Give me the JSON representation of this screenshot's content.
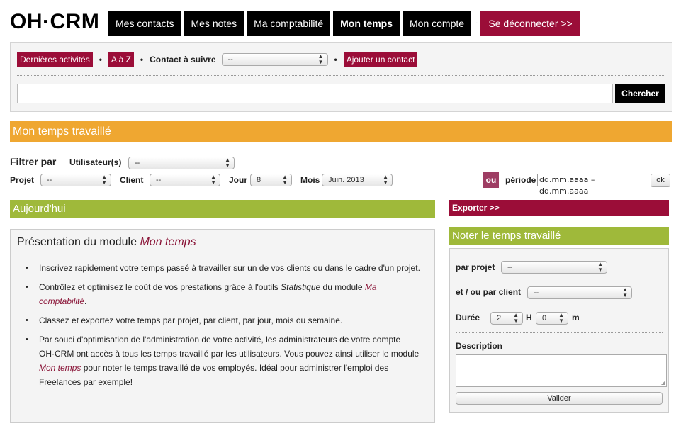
{
  "logo": "OH·CRM",
  "nav": {
    "tabs": [
      "Mes contacts",
      "Mes notes",
      "Ma comptabilité",
      "Mon temps",
      "Mon compte"
    ],
    "separator": "·",
    "logout": "Se déconnecter >>"
  },
  "toolbar": {
    "recent": "Dernières activités",
    "dot": "•",
    "az": "A à Z",
    "follow_label": "Contact à suivre",
    "follow_value": "--",
    "add_contact": "Ajouter un contact",
    "search_placeholder": "",
    "search_button": "Chercher"
  },
  "section_title": "Mon temps travaillé",
  "filters": {
    "title": "Filtrer par",
    "user_label": "Utilisateur(s)",
    "user_value": "--",
    "project_label": "Projet",
    "project_value": "--",
    "client_label": "Client",
    "client_value": "--",
    "day_label": "Jour",
    "day_value": "8",
    "month_label": "Mois",
    "month_value": "Juin. 2013",
    "or_button": "ou",
    "period_label": "période",
    "period_value": "dd.mm.aaaa – dd.mm.aaaa",
    "ok_button": "ok"
  },
  "today": {
    "title": "Aujourd'hui",
    "box_title_prefix": "Présentation du module ",
    "box_title_em": "Mon temps",
    "bullets": [
      {
        "text": "Inscrivez rapidement votre temps passé à travailler sur un de vos clients ou dans le cadre d'un projet."
      },
      {
        "pre": "Contrôlez et optimisez le coût de vos prestations grâce à l'outils ",
        "em1": "Statistique",
        "mid": " du module ",
        "em2": "Ma comptabilité",
        "post": "."
      },
      {
        "text": "Classez et exportez votre temps par projet, par client, par jour, mois ou semaine."
      },
      {
        "pre": "Par souci d'optimisation de l'administration de votre activité, les administrateurs de votre compte OH·CRM ont accès à tous les temps travaillé par les utilisateurs. Vous pouvez ainsi utiliser le module ",
        "em": "Mon temps",
        "post": " pour noter le temps travaillé de vos employés. Idéal pour administrer l'emploi des Freelances par exemple!"
      }
    ]
  },
  "export": "Exporter >>",
  "log_time": {
    "title": "Noter le temps travaillé",
    "project_label": "par projet",
    "project_value": "--",
    "client_label": "et / ou par client",
    "client_value": "--",
    "duration_label": "Durée",
    "hours_value": "2",
    "hours_unit": "H",
    "minutes_value": "0",
    "minutes_unit": "m",
    "description_label": "Description",
    "submit": "Valider"
  },
  "colors": {
    "brand_red": "#9b0d38",
    "orange": "#efa731",
    "green": "#9fb93a",
    "black": "#000000"
  }
}
